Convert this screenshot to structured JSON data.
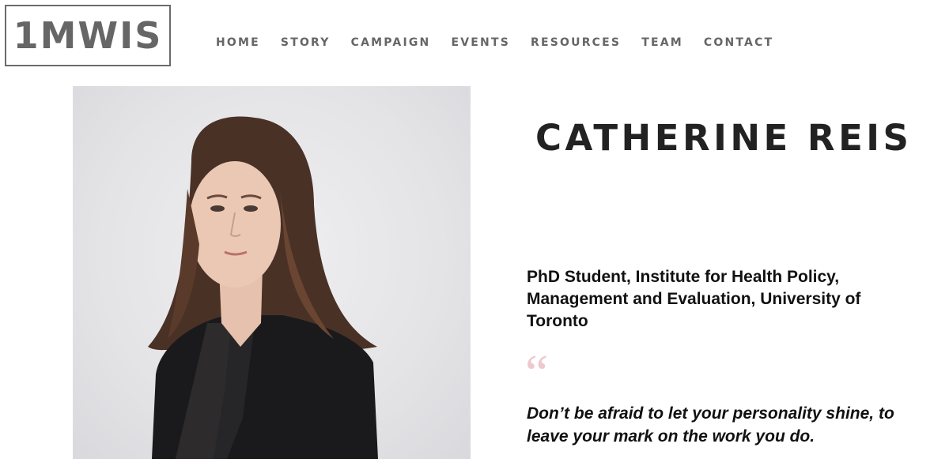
{
  "logo": {
    "text": "1MWIS"
  },
  "nav": {
    "items": [
      {
        "label": "HOME"
      },
      {
        "label": "STORY"
      },
      {
        "label": "CAMPAIGN"
      },
      {
        "label": "EVENTS"
      },
      {
        "label": "RESOURCES"
      },
      {
        "label": "TEAM"
      },
      {
        "label": "CONTACT"
      }
    ]
  },
  "profile": {
    "name": "CATHERINE REIS",
    "role": "PhD Student, Institute for Health Policy, Management and Evaluation, University of Toronto",
    "quote_mark": "“",
    "quote": "Don’t be afraid to let your personality shine, to leave your mark on the work you do."
  },
  "colors": {
    "nav_text": "#666666",
    "logo": "#666666",
    "name": "#222222",
    "quote_mark": "#eec8cf"
  }
}
